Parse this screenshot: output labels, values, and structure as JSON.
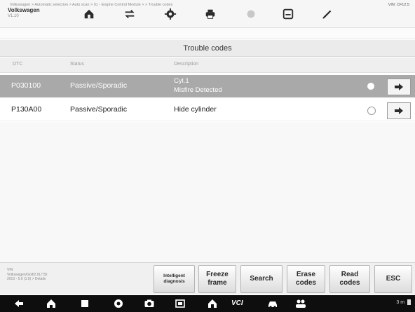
{
  "header": {
    "vehicle_title": "Volkswagen",
    "version": "V1.10",
    "tools": [
      "home-icon",
      "vehicle-swap-icon",
      "settings-icon",
      "print-icon",
      "help-icon",
      "save-icon",
      "pen-icon"
    ]
  },
  "breadcrumb": "Volkswagen > Automatic selection > Auto scan > 01 - Engine Control Module > > Trouble codes",
  "vin": "VIN: CF12.5",
  "page_title": "Trouble codes",
  "columns": [
    "DTC",
    "Status",
    "Description"
  ],
  "rows": [
    {
      "code": "P030100",
      "status": "Passive/Sporadic",
      "description_line1": "Cyl.1",
      "description_line2": "Misfire Detected",
      "selected": true
    },
    {
      "code": "P130A00",
      "status": "Passive/Sporadic",
      "description_line1": "Hide cylinder",
      "description_line2": "",
      "selected": false
    }
  ],
  "vehicle_info": [
    "VIN",
    "Volkswagen/Golf/2.0L/TSI",
    "2013 - 5.0 (1.0) > Details"
  ],
  "buttons": {
    "intelligent": "Intelligent diagnosis",
    "freeze": "Freeze frame",
    "search": "Search",
    "erase": "Erase codes",
    "read": "Read codes",
    "esc": "ESC"
  },
  "nav": {
    "vci_label": "VCI",
    "status_text": "3 m"
  },
  "colors": {
    "selected_row": "#a9a9a9",
    "nav_bar": "#0e0e0e",
    "header_bg": "#f6f6f6"
  }
}
